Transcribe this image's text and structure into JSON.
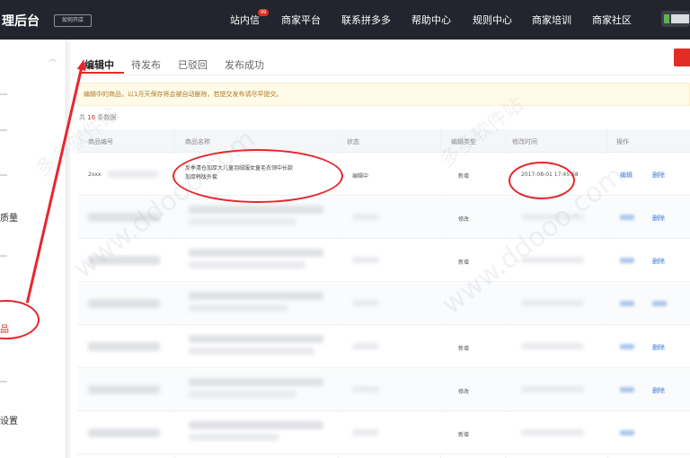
{
  "topbar": {
    "brand": "理后台",
    "badge": "如何开店",
    "nav": [
      {
        "label": "站内信",
        "badge": "99"
      },
      {
        "label": "商家平台"
      },
      {
        "label": "联系拼多多"
      },
      {
        "label": "帮助中心"
      },
      {
        "label": "规则中心"
      },
      {
        "label": "商家培训"
      },
      {
        "label": "商家社区"
      }
    ]
  },
  "sidebar": {
    "items": [
      {
        "label": "质量"
      },
      {
        "label": "品"
      },
      {
        "label": "设置"
      }
    ]
  },
  "tabs": [
    {
      "label": "编辑中"
    },
    {
      "label": "待发布"
    },
    {
      "label": "已驳回"
    },
    {
      "label": "发布成功"
    }
  ],
  "notice": "编辑中的商品，以1月天保存将会被自动删除，若提交发布请尽早提交。",
  "count": {
    "prefix": "共",
    "number": "16",
    "suffix": "条数据"
  },
  "table": {
    "columns": [
      "商品编号",
      "商品名称",
      "状态",
      "编辑类型",
      "修改时间",
      "操作"
    ],
    "first_row": {
      "id": "2xxx",
      "name": "反季清仓加厚大儿童羽绒服女童毛衣领中长款加厚韩版外套",
      "status": "编辑中",
      "type": "新增",
      "time": "2017-08-01 17:45:58",
      "actions": [
        "编辑",
        "删除"
      ]
    },
    "rows": [
      {
        "type": "修改",
        "action": "删除"
      },
      {
        "type": "新增",
        "action": "删除"
      },
      {
        "type": "",
        "action": ""
      },
      {
        "type": "新增",
        "action": "删除"
      },
      {
        "type": "修改",
        "action": "删除"
      },
      {
        "type": "新增",
        "action": ""
      }
    ]
  },
  "watermark": "www.ddooo.com",
  "watermark_cn": "多多软件站",
  "colors": {
    "accent": "#e02e24",
    "annotation": "#e8262c",
    "topbar": "#23252e",
    "link": "#3a7bd5"
  }
}
